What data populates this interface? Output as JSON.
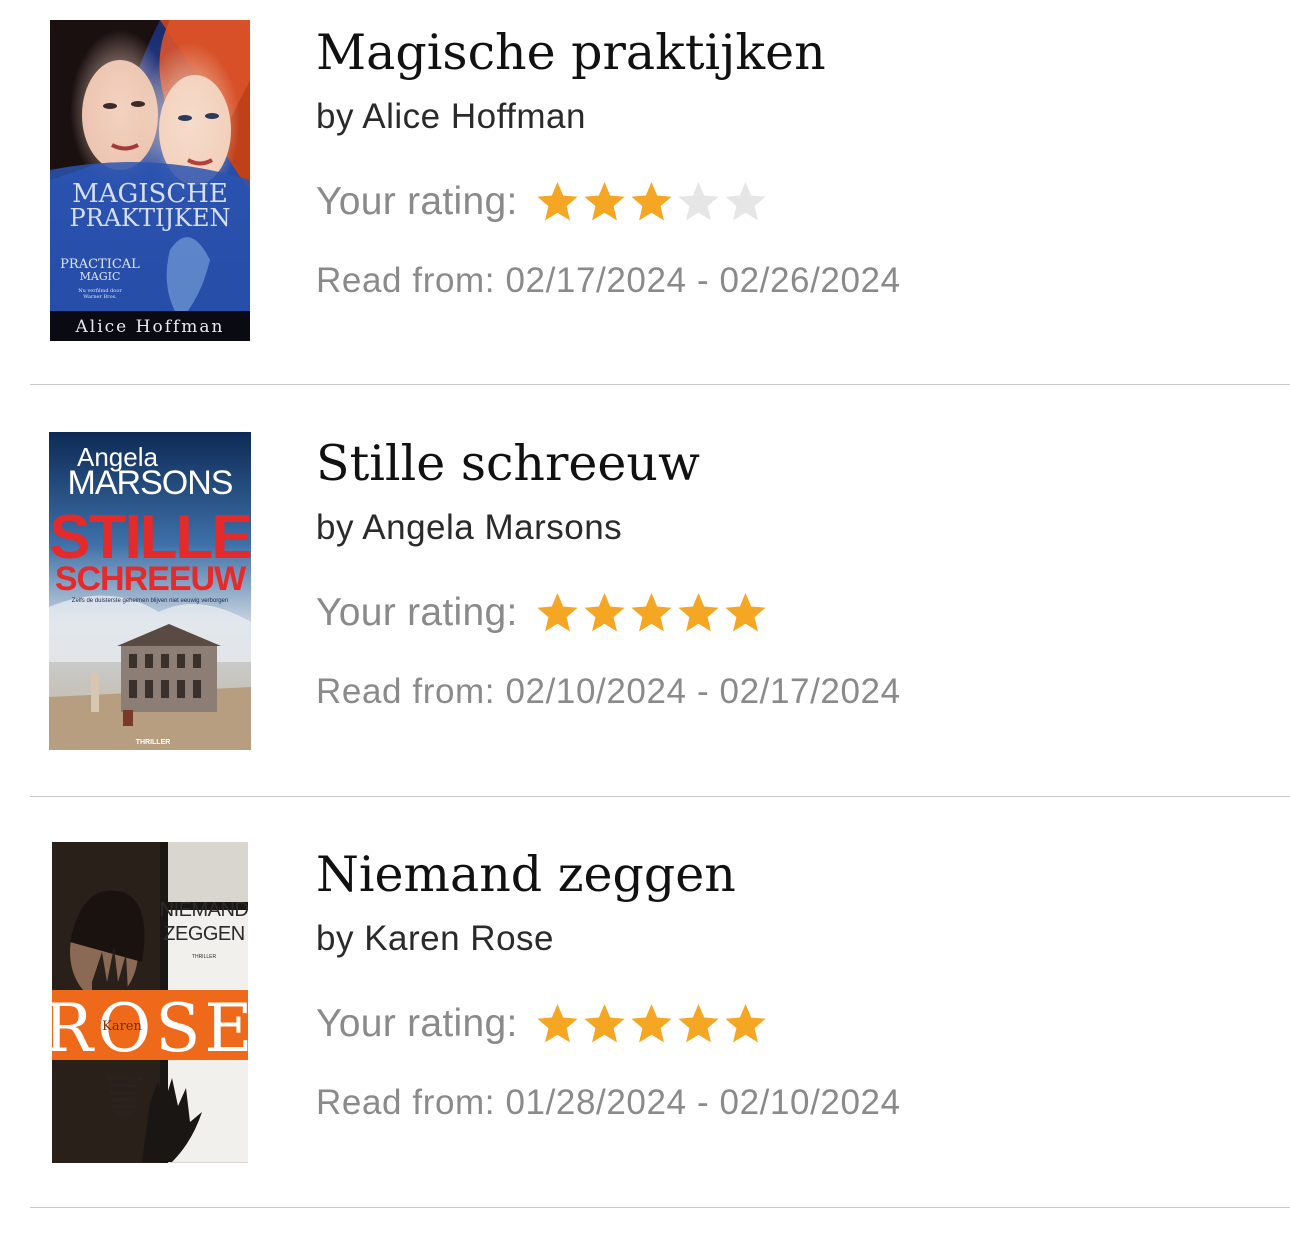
{
  "reading_list": {
    "books": [
      {
        "title": "Magische praktijken",
        "author": "by Alice Hoffman",
        "rating_label": "Your rating:",
        "rating": 3,
        "rating_max": 5,
        "dates": "Read from: 02/17/2024 - 02/26/2024",
        "cover": {
          "title_line1": "MAGISCHE",
          "title_line2": "PRAKTIJKEN",
          "subtitle_line1": "PRACTICAL",
          "subtitle_line2": "MAGIC",
          "tagline_line1": "Nu verfilmd door",
          "tagline_line2": "Warner Bros.",
          "author": "Alice Hoffman"
        }
      },
      {
        "title": "Stille schreeuw",
        "author": "by Angela Marsons",
        "rating_label": "Your rating:",
        "rating": 5,
        "rating_max": 5,
        "dates": "Read from: 02/10/2024 - 02/17/2024",
        "cover": {
          "author_first": "Angela",
          "author_last": "MARSONS",
          "title_line1": "STILLE",
          "title_line2": "SCHREEUW",
          "tagline": "Zelfs de duisterste geheimen blijven niet eeuwig verborgen",
          "genre": "THRILLER"
        }
      },
      {
        "title": "Niemand zeggen",
        "author": "by Karen Rose",
        "rating_label": "Your rating:",
        "rating": 5,
        "rating_max": 5,
        "dates": "Read from: 01/28/2024 - 02/10/2024",
        "cover": {
          "title_line1": "NIEMAND",
          "title_line2": "ZEGGEN",
          "genre": "THRILLER",
          "author_first": "Karen",
          "author_last": "ROSE",
          "quote_line1": "'De thrillers van",
          "quote_line2": "Karen Rose",
          "quote_line3": "bezorgen je",
          "quote_line4": "kippenvel.'",
          "quote_source1": "Publishers",
          "quote_source2": "Weekly"
        }
      }
    ]
  },
  "colors": {
    "star_filled": "#F5A623",
    "star_empty": "#E6E6E6",
    "divider": "#C8C8C8",
    "muted_text": "#8A8A8A",
    "title_text": "#111111"
  }
}
